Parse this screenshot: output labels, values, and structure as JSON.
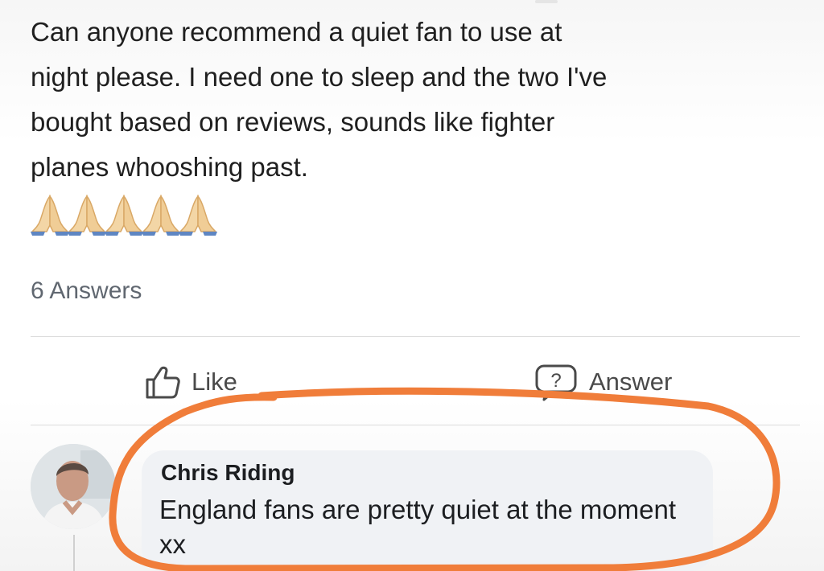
{
  "post": {
    "text": "Can anyone recommend a quiet fan to use at\nnight please. I need one to sleep and the two I've\nbought based on reviews, sounds like fighter\nplanes whooshing past.",
    "prayer_emoji_count": 5
  },
  "answers_count": "6 Answers",
  "actions": {
    "like_label": "Like",
    "answer_label": "Answer"
  },
  "comment": {
    "author": "Chris Riding",
    "text": "England fans are pretty quiet at the moment xx"
  },
  "annotation": {
    "color": "#f07d3a"
  },
  "icons": {
    "prayer": "folded-hands-icon",
    "like": "thumbs-up-icon",
    "answer": "question-bubble-icon"
  }
}
